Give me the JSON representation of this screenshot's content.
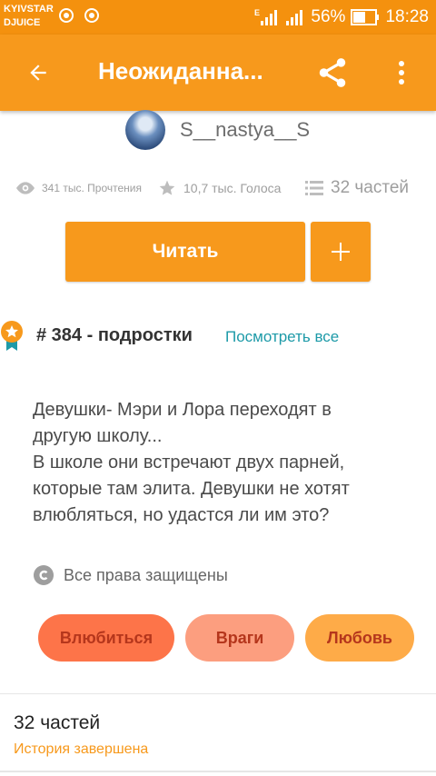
{
  "status_bar": {
    "carrier_line1": "KYIVSTAR",
    "carrier_line2": "DJUICE",
    "battery": "56%",
    "time": "18:28",
    "network_indicator": "E"
  },
  "app_bar": {
    "title": "Неожиданна...",
    "icons": [
      "back-arrow-icon",
      "share-icon",
      "more-vert-icon"
    ]
  },
  "author": {
    "name": "S__nastya__S"
  },
  "stats": {
    "reads": "341 тыс. Прочтения",
    "votes": "10,7 тыс. Голоса",
    "parts": "32 частей"
  },
  "actions": {
    "read_label": "Читать",
    "add_label": "+"
  },
  "ranking": {
    "text": "# 384 - подростки",
    "see_all": "Посмотреть все"
  },
  "description": {
    "lines": [
      "Девушки- Мэри и Лора переходят в",
      "другую школу...",
      "В школе они встречают двух парней,",
      "которые там элита. Девушки не хотят",
      "влюбляться, но удастся ли им это?"
    ]
  },
  "rights": {
    "text": "Все права защищены"
  },
  "tags": [
    {
      "label": "Влюбиться",
      "color": "#fd7449"
    },
    {
      "label": "Враги",
      "color": "#fc9e7f"
    },
    {
      "label": "Любовь",
      "color": "#feab48"
    }
  ],
  "parts_section": {
    "title": "32 частей",
    "status": "История завершена"
  },
  "colors": {
    "accent": "#f7991c",
    "link": "#1d9aa8",
    "tag_text": "#b5361c"
  }
}
